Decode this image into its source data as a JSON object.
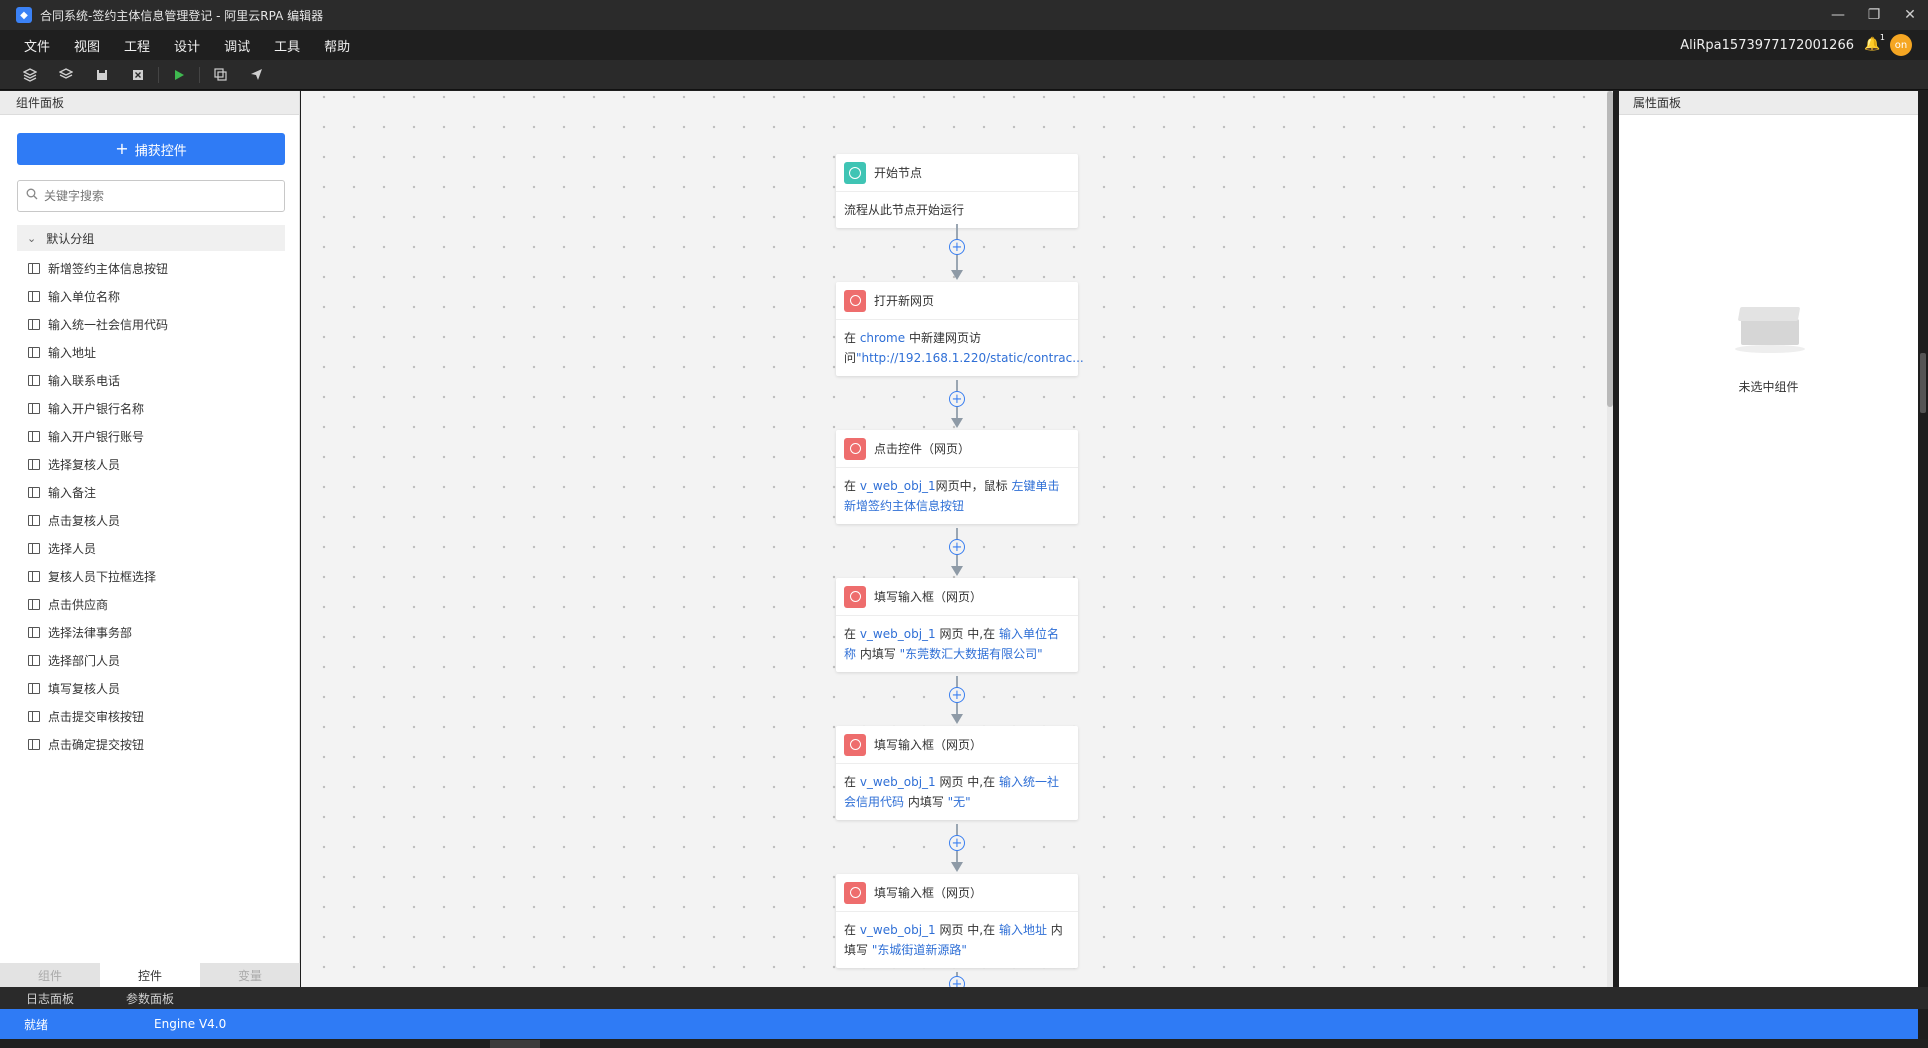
{
  "window": {
    "title": "合同系统-签约主体信息管理登记 - 阿里云RPA 编辑器",
    "controls": [
      "—",
      "❐",
      "✕"
    ]
  },
  "menu": {
    "items": [
      "文件",
      "视图",
      "工程",
      "设计",
      "调试",
      "工具",
      "帮助"
    ],
    "user": "AliRpa1573977172001266",
    "bell_badge": "1",
    "avatar_text": "on"
  },
  "toolbar": {
    "icons": [
      "layers-icon",
      "layers-alt-icon",
      "save-icon",
      "close-file-icon",
      "run-icon",
      "copy-icon",
      "publish-icon"
    ]
  },
  "left_panel": {
    "title": "组件面板",
    "capture_button": "捕获控件",
    "search_placeholder": "关键字搜索",
    "group_label": "默认分组",
    "controls": [
      "新增签约主体信息按钮",
      "输入单位名称",
      "输入统一社会信用代码",
      "输入地址",
      "输入联系电话",
      "输入开户银行名称",
      "输入开户银行账号",
      "选择复核人员",
      "输入备注",
      "点击复核人员",
      "选择人员",
      "复核人员下拉框选择",
      "点击供应商",
      "选择法律事务部",
      "选择部门人员",
      "填写复核人员",
      "点击提交审核按钮",
      "点击确定提交按钮"
    ],
    "tabs": [
      "组件",
      "控件",
      "变量"
    ],
    "active_tab": "控件"
  },
  "flow": {
    "nodes": [
      {
        "title": "开始节点",
        "kind": "start",
        "body": [
          {
            "t": "流程从此节点开始运行",
            "link": false
          }
        ]
      },
      {
        "title": "打开新网页",
        "kind": "web",
        "body": [
          {
            "t": "在 ",
            "link": false
          },
          {
            "t": "chrome",
            "link": true
          },
          {
            "t": " 中新建网页访问",
            "link": false
          },
          {
            "t": "\"http://192.168.1.220/static/contrac...",
            "link": true
          }
        ]
      },
      {
        "title": "点击控件（网页）",
        "kind": "web",
        "body": [
          {
            "t": "在 ",
            "link": false
          },
          {
            "t": "v_web_obj_1",
            "link": true
          },
          {
            "t": "网页中，鼠标 ",
            "link": false
          },
          {
            "t": "左键单击",
            "link": true
          },
          {
            "t": " ",
            "link": false
          },
          {
            "t": "新增签约主体信息按钮",
            "link": true
          }
        ]
      },
      {
        "title": "填写输入框（网页）",
        "kind": "web",
        "body": [
          {
            "t": "在 ",
            "link": false
          },
          {
            "t": "v_web_obj_1",
            "link": true
          },
          {
            "t": " 网页 中,在 ",
            "link": false
          },
          {
            "t": "输入单位名称",
            "link": true
          },
          {
            "t": " 内填写 ",
            "link": false
          },
          {
            "t": "\"东莞数汇大数据有限公司\"",
            "link": true
          }
        ]
      },
      {
        "title": "填写输入框（网页）",
        "kind": "web",
        "body": [
          {
            "t": "在 ",
            "link": false
          },
          {
            "t": "v_web_obj_1",
            "link": true
          },
          {
            "t": " 网页 中,在 ",
            "link": false
          },
          {
            "t": "输入统一社会信用代码",
            "link": true
          },
          {
            "t": " 内填写 ",
            "link": false
          },
          {
            "t": "\"无\"",
            "link": true
          }
        ]
      },
      {
        "title": "填写输入框（网页）",
        "kind": "web",
        "body": [
          {
            "t": "在 ",
            "link": false
          },
          {
            "t": "v_web_obj_1",
            "link": true
          },
          {
            "t": " 网页 中,在 ",
            "link": false
          },
          {
            "t": "输入地址",
            "link": true
          },
          {
            "t": " 内填写 ",
            "link": false
          },
          {
            "t": "\"东城街道新源路\"",
            "link": true
          }
        ]
      }
    ]
  },
  "right_panel": {
    "title": "属性面板",
    "empty_text": "未选中组件"
  },
  "bottom": {
    "tabs": [
      "日志面板",
      "参数面板"
    ],
    "status": "就绪",
    "engine": "Engine V4.0"
  }
}
